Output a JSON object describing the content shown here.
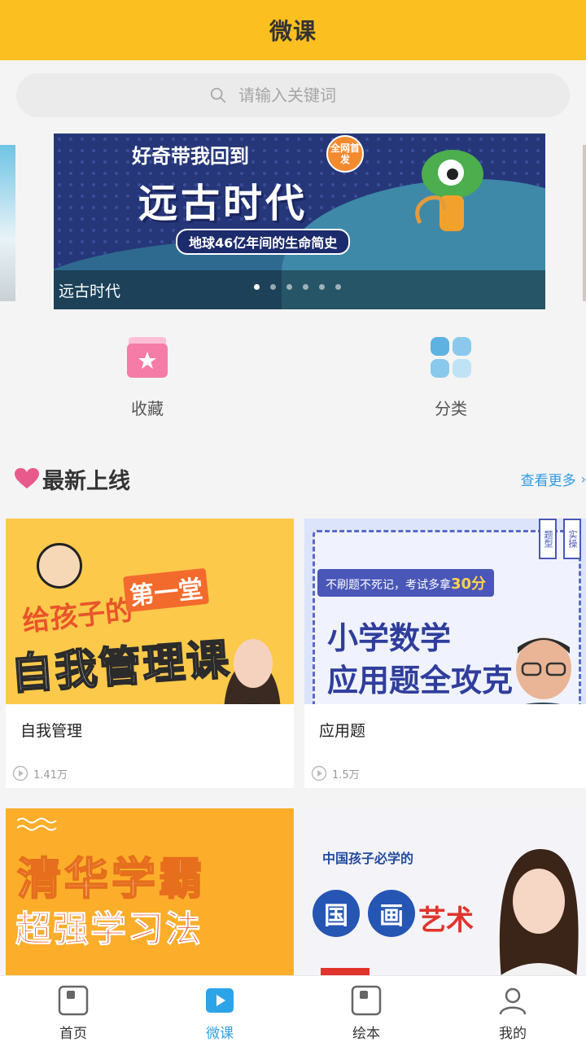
{
  "header": {
    "title": "微课"
  },
  "search": {
    "placeholder": "请输入关键词"
  },
  "banner": {
    "headline_small": "好奇带我回到",
    "headline_big": "远古时代",
    "subtitle": "地球46亿年间的生命简史",
    "badge": "全网首发",
    "caption": "远古时代",
    "slide_count": 6,
    "active_slide": 1
  },
  "quick_actions": [
    {
      "label": "收藏",
      "icon": "favorite-box-icon"
    },
    {
      "label": "分类",
      "icon": "category-grid-icon"
    }
  ],
  "section": {
    "title": "最新上线",
    "more_label": "查看更多"
  },
  "courses": [
    {
      "title": "自我管理",
      "plays": "1.41万",
      "thumb_text": {
        "line1": "给孩子的",
        "line1b": "第一堂",
        "line2": "自我管理课"
      }
    },
    {
      "title": "应用题",
      "plays": "1.5万",
      "thumb_text": {
        "pill": "不刷题不死记，考试多拿",
        "pill_num": "30分",
        "line1": "小学数学",
        "line2": "应用题全攻克",
        "tab1": "题型",
        "tab2": "实操"
      }
    },
    {
      "title": "",
      "plays": "",
      "thumb_text": {
        "line1": "清华学霸",
        "line2": "超强学习法"
      }
    },
    {
      "title": "",
      "plays": "",
      "thumb_text": {
        "line1": "中国孩子必学的",
        "c1": "国",
        "c2": "画",
        "art": "艺术"
      }
    }
  ],
  "tabbar": [
    {
      "label": "首页",
      "icon": "home-icon",
      "active": false
    },
    {
      "label": "微课",
      "icon": "video-play-icon",
      "active": true
    },
    {
      "label": "绘本",
      "icon": "picture-book-icon",
      "active": false
    },
    {
      "label": "我的",
      "icon": "profile-icon",
      "active": false
    }
  ],
  "colors": {
    "header": "#fbbf1f",
    "accent_blue": "#2ea4e8",
    "heart": "#e85a8c"
  }
}
